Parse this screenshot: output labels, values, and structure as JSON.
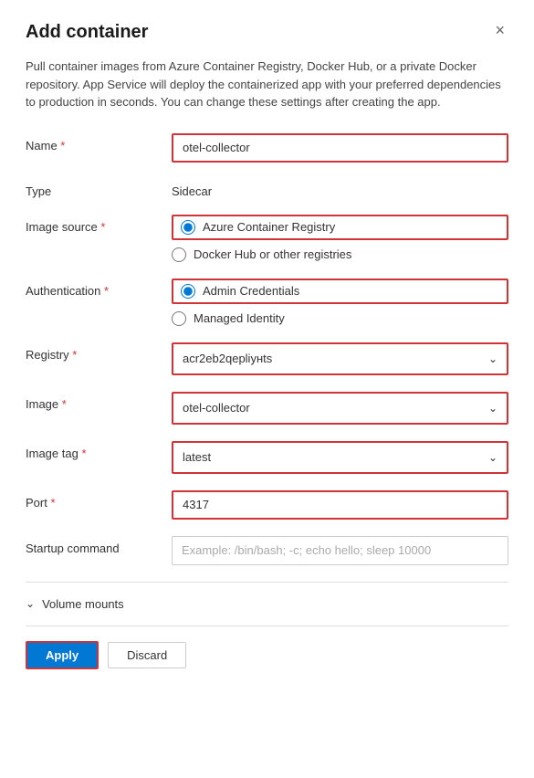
{
  "dialog": {
    "title": "Add container",
    "description": "Pull container images from Azure Container Registry, Docker Hub, or a private Docker repository. App Service will deploy the containerized app with your preferred dependencies to production in seconds. You can change these settings after creating the app.",
    "close_label": "×"
  },
  "form": {
    "name_label": "Name",
    "name_required": " *",
    "name_value": "otel-collector",
    "type_label": "Type",
    "type_value": "Sidecar",
    "image_source_label": "Image source",
    "image_source_required": " *",
    "image_source_options": [
      {
        "id": "acr",
        "label": "Azure Container Registry",
        "selected": true
      },
      {
        "id": "dockerhub",
        "label": "Docker Hub or other registries",
        "selected": false
      }
    ],
    "authentication_label": "Authentication",
    "authentication_required": " *",
    "authentication_options": [
      {
        "id": "admin",
        "label": "Admin Credentials",
        "selected": true
      },
      {
        "id": "managed",
        "label": "Managed Identity",
        "selected": false
      }
    ],
    "registry_label": "Registry",
    "registry_required": " *",
    "registry_value": "acr2eb2qepliунts",
    "registry_display": "acr2eb2qepliунts",
    "image_label": "Image",
    "image_required": " *",
    "image_value": "otel-collector",
    "image_tag_label": "Image tag",
    "image_tag_required": " *",
    "image_tag_value": "latest",
    "port_label": "Port",
    "port_required": " *",
    "port_value": "4317",
    "startup_label": "Startup command",
    "startup_placeholder": "Example: /bin/bash; -c; echo hello; sleep 10000",
    "volume_mounts_label": "Volume mounts"
  },
  "footer": {
    "apply_label": "Apply",
    "discard_label": "Discard"
  }
}
